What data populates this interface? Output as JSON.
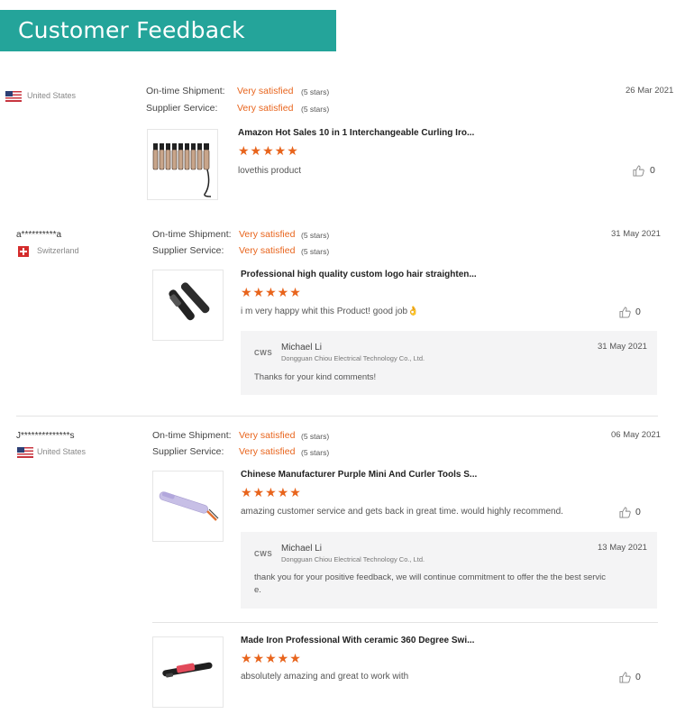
{
  "header": {
    "title": "Customer Feedback"
  },
  "labels": {
    "shipment": "On-time Shipment:",
    "service": "Supplier Service:"
  },
  "reviews": [
    {
      "buyer": "",
      "country": "United States",
      "date": "26 Mar 2021",
      "shipment_rating": "Very satisfied",
      "shipment_stars": "(5 stars)",
      "service_rating": "Very satisfied",
      "service_stars": "(5 stars)",
      "product_title": "Amazon Hot Sales 10 in 1 Interchangeable Curling Iro...",
      "rating": "★★★★★",
      "comment": "lovethis product",
      "likes": "0"
    },
    {
      "buyer": "a**********a",
      "country": "Switzerland",
      "date": "31 May 2021",
      "shipment_rating": "Very satisfied",
      "shipment_stars": "(5 stars)",
      "service_rating": "Very satisfied",
      "service_stars": "(5 stars)",
      "product_title": "Professional high quality custom logo hair straighten...",
      "rating": "★★★★★",
      "comment": "i m very happy whit this Product! good job👌",
      "likes": "0",
      "reply": {
        "logo": "CWS",
        "name": "Michael Li",
        "company": "Dongguan Chiou Electrical Technology Co., Ltd.",
        "date": "31 May 2021",
        "text": "Thanks for your kind comments!"
      }
    },
    {
      "buyer": "J**************s",
      "country": "United States",
      "date": "06 May 2021",
      "shipment_rating": "Very satisfied",
      "shipment_stars": "(5 stars)",
      "service_rating": "Very satisfied",
      "service_stars": "(5 stars)",
      "product_title": "Chinese Manufacturer Purple Mini And Curler Tools S...",
      "rating": "★★★★★",
      "comment": "amazing customer service and gets back in great time. would highly recommend.",
      "likes": "0",
      "reply": {
        "logo": "CWS",
        "name": "Michael Li",
        "company": "Dongguan Chiou Electrical Technology Co., Ltd.",
        "date": "13 May 2021",
        "text_line1": "thank you for your positive feedback, we will continue commitment to offer the the best servic",
        "text_line2": "e."
      },
      "extra_item": {
        "product_title": "Made Iron Professional With ceramic 360 Degree Swi...",
        "rating": "★★★★★",
        "comment": "absolutely amazing and great to work with",
        "likes": "0"
      }
    }
  ],
  "colors": {
    "accent": "#24a49a",
    "satisfied": "#e8641c",
    "stars": "#e8641c"
  }
}
